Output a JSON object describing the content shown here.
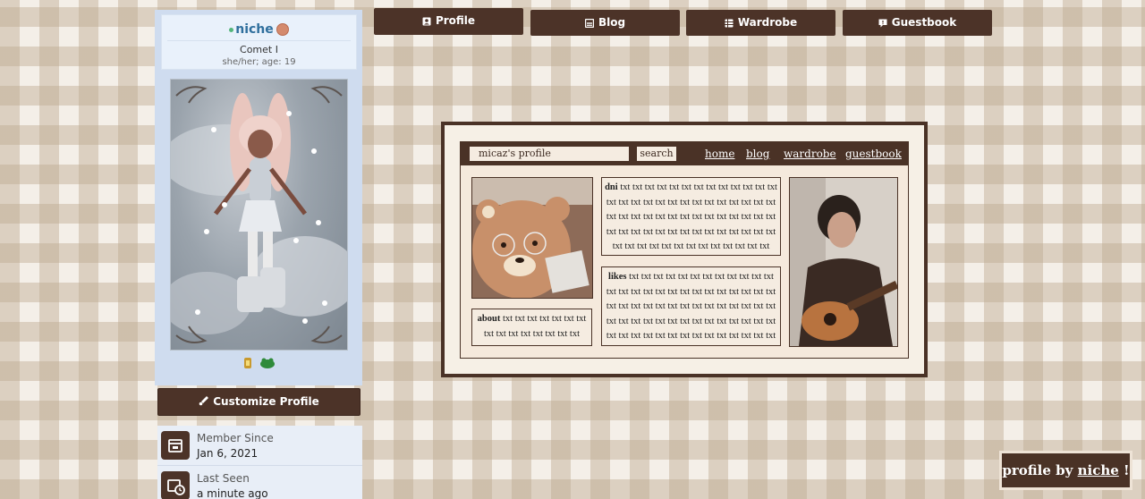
{
  "user": {
    "name": "niche",
    "title": "Comet I",
    "pronouns": "she/her; age: 19"
  },
  "sidebar": {
    "customize_label": "Customize Profile",
    "member_since_label": "Member Since",
    "member_since_value": "Jan 6, 2021",
    "last_seen_label": "Last Seen",
    "last_seen_value": "a minute ago"
  },
  "tabs": [
    {
      "label": "Profile",
      "icon": "profile-icon"
    },
    {
      "label": "Blog",
      "icon": "blog-icon"
    },
    {
      "label": "Wardrobe",
      "icon": "wardrobe-icon"
    },
    {
      "label": "Guestbook",
      "icon": "guestbook-icon"
    }
  ],
  "profile_card": {
    "search_placeholder": "micaz's profile",
    "search_button": "search",
    "nav": [
      "home",
      "blog",
      "wardrobe",
      "guestbook"
    ],
    "dni_heading": "dni",
    "dni_text": "txt txt txt txt txt txt txt txt txt txt txt txt txt txt txt txt txt txt txt txt txt txt txt txt txt txt txt txt txt txt txt txt txt txt txt txt txt txt txt txt txt txt txt txt txt txt txt txt txt txt txt txt txt txt txt txt txt txt txt txt txt txt txt txt txt txt txt txt",
    "likes_heading": "likes",
    "likes_text": "txt txt txt txt txt txt txt txt txt txt txt txt txt txt txt txt txt txt txt txt txt txt txt txt txt txt txt txt txt txt txt txt txt txt txt txt txt txt txt txt txt txt txt txt txt txt txt txt txt txt txt txt txt txt txt txt txt txt txt txt txt txt txt txt txt txt txt txt",
    "about_heading": "about",
    "about_text": "txt txt txt txt txt txt txt txt txt txt txt txt txt txt txt"
  },
  "credit": {
    "prefix": "profile by",
    "name": "niche",
    "suffix": "!"
  },
  "colors": {
    "brown": "#4c3328",
    "sidebar_blue": "#cfdcef",
    "username_blue": "#2f6f9d"
  }
}
